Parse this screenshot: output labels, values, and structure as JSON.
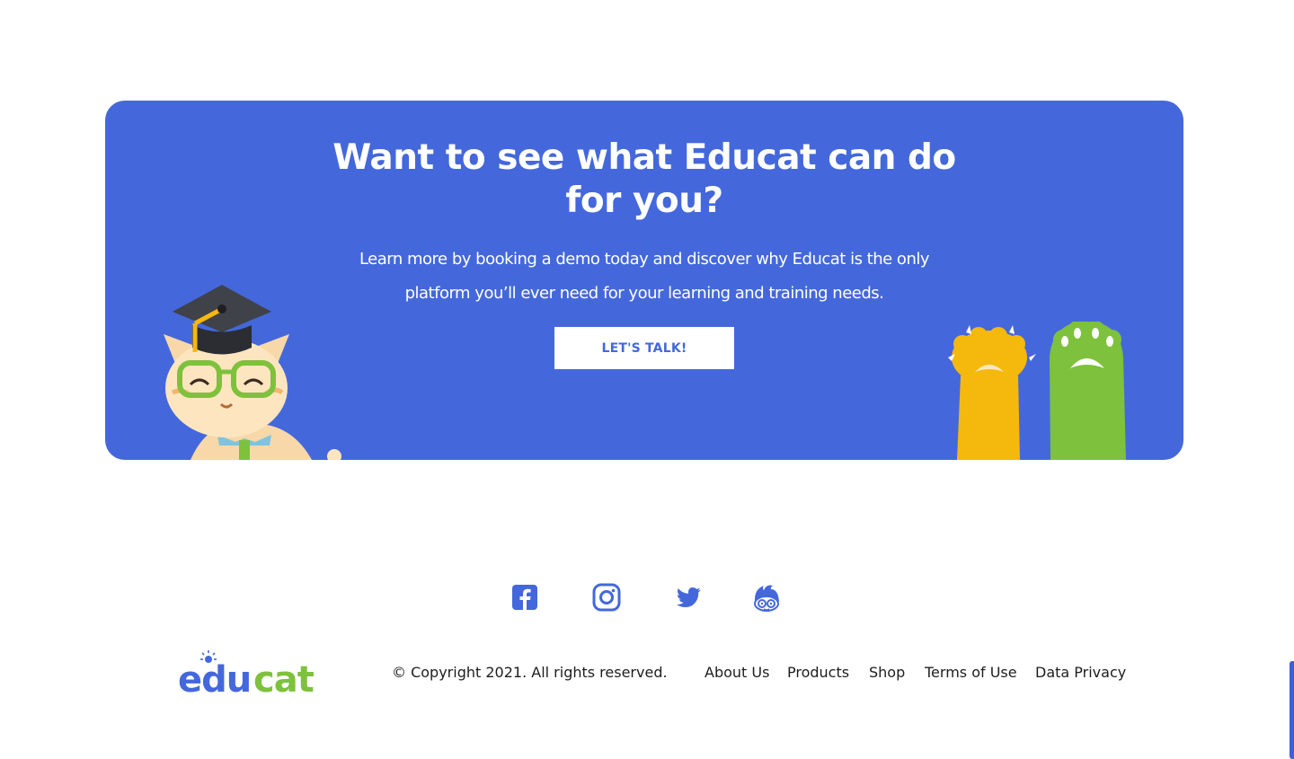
{
  "cta": {
    "title": "Want to see what Educat can do for you?",
    "text": "Learn more by booking a demo today and discover why Educat is the only platform you’ll ever need for your learning and training needs.",
    "button_label": "LET'S TALK!"
  },
  "footer": {
    "logo_text": "educat",
    "copyright": "© Copyright 2021. All rights reserved.",
    "links": [
      "About Us",
      "Products",
      "Shop",
      "Terms of Use",
      "Data Privacy"
    ],
    "social": [
      "facebook-icon",
      "instagram-icon",
      "twitter-icon",
      "educat-mascot-icon"
    ]
  },
  "colors": {
    "brand_blue": "#4468db",
    "logo_green": "#7ec13d",
    "paw_yellow": "#f5b80d"
  }
}
